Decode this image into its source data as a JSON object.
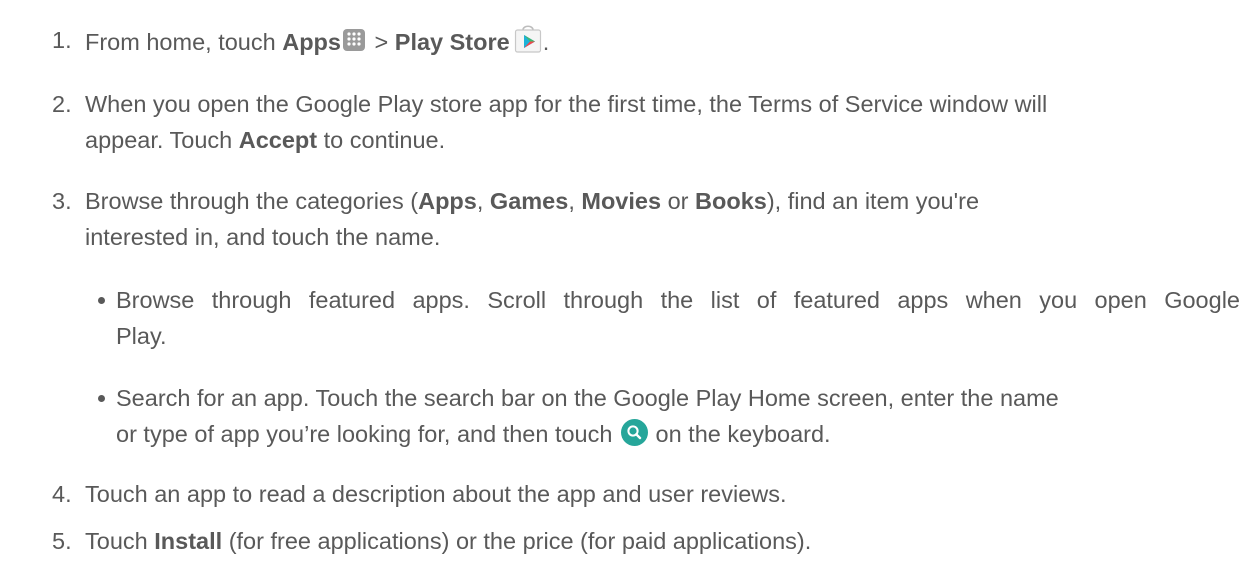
{
  "steps": [
    {
      "num": "1.",
      "pre": "From home, touch ",
      "b1": "Apps",
      "mid": " > ",
      "b2": "Play Store",
      "post": "."
    },
    {
      "num": "2.",
      "line1": "When you open the Google Play store app for the first time, the Terms of Service window will",
      "line2_pre": "appear. Touch ",
      "b1": "Accept",
      "line2_post": " to continue."
    },
    {
      "num": "3.",
      "pre": "Browse through the categories (",
      "b1": "Apps",
      "s1": ", ",
      "b2": "Games",
      "s2": ", ",
      "b3": "Movies",
      "s3": " or ",
      "b4": "Books",
      "post": "), find an item you're",
      "line2": "interested in, and touch the name."
    },
    {
      "num": "4.",
      "text": "Touch an app to read a description about the app and user reviews."
    },
    {
      "num": "5.",
      "pre": "Touch ",
      "b1": "Install",
      "post": " (for free applications) or the price (for paid applications)."
    }
  ],
  "bullets": [
    {
      "line1": "Browse through featured apps. Scroll through the list of featured apps when you open Google",
      "line2": "Play."
    },
    {
      "line1": "Search for an app. Touch the search bar on the Google Play Home screen, enter the name",
      "line2_pre": "or type of app you’re looking for, and then touch ",
      "line2_post": " on the keyboard."
    }
  ],
  "icons": {
    "apps": "apps-grid-icon",
    "play_store": "play-store-icon",
    "search": "search-icon"
  },
  "colors": {
    "text": "#595959",
    "search_icon_bg": "#26a69a",
    "apps_icon_bg": "#9a9a9a"
  }
}
